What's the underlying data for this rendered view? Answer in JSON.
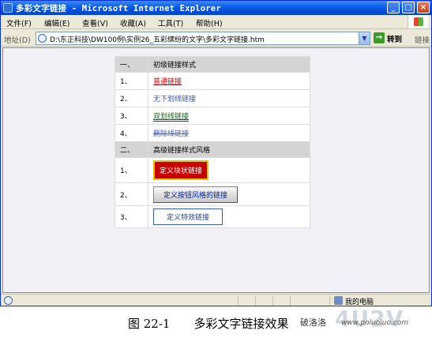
{
  "window": {
    "title": "多彩文字链接 - Microsoft Internet Explorer",
    "minimize": "_",
    "maximize": "□",
    "close": "×"
  },
  "menu": [
    "文件(F)",
    "编辑(E)",
    "查看(V)",
    "收藏(A)",
    "工具(T)",
    "帮助(H)"
  ],
  "address": {
    "label": "地址(D)",
    "value": "D:\\东正科技\\DW100例\\实例26_五彩缤纷的文字\\多彩文字链接.htm",
    "go_label": "转到",
    "links_label": "链接"
  },
  "table": {
    "section1": {
      "num": "一、",
      "title": "初级链接样式"
    },
    "basic_links": [
      {
        "num": "1、",
        "label": "普通链接"
      },
      {
        "num": "2、",
        "label": "无下划线链接"
      },
      {
        "num": "3、",
        "label": "双划线链接"
      },
      {
        "num": "4、",
        "label": "删除线链接"
      }
    ],
    "section2": {
      "num": "二、",
      "title": "高级链接样式风格"
    },
    "advanced_links": [
      {
        "num": "1、",
        "label": "定义块状链接"
      },
      {
        "num": "2、",
        "label": "定义按钮风格的链接"
      },
      {
        "num": "3、",
        "label": "定义特效链接"
      }
    ]
  },
  "status": {
    "zone": "我的电脑"
  },
  "caption": "图 22-1　　多彩文字链接效果",
  "watermark": {
    "cn": "破洛洛",
    "big": "4U2V",
    "url": "www.poluoluo.com"
  },
  "colors": {
    "titlebar": "#0a5ce6",
    "link_red": "#cc0000",
    "block_bg": "#c80000",
    "block_border": "#e8c000"
  }
}
